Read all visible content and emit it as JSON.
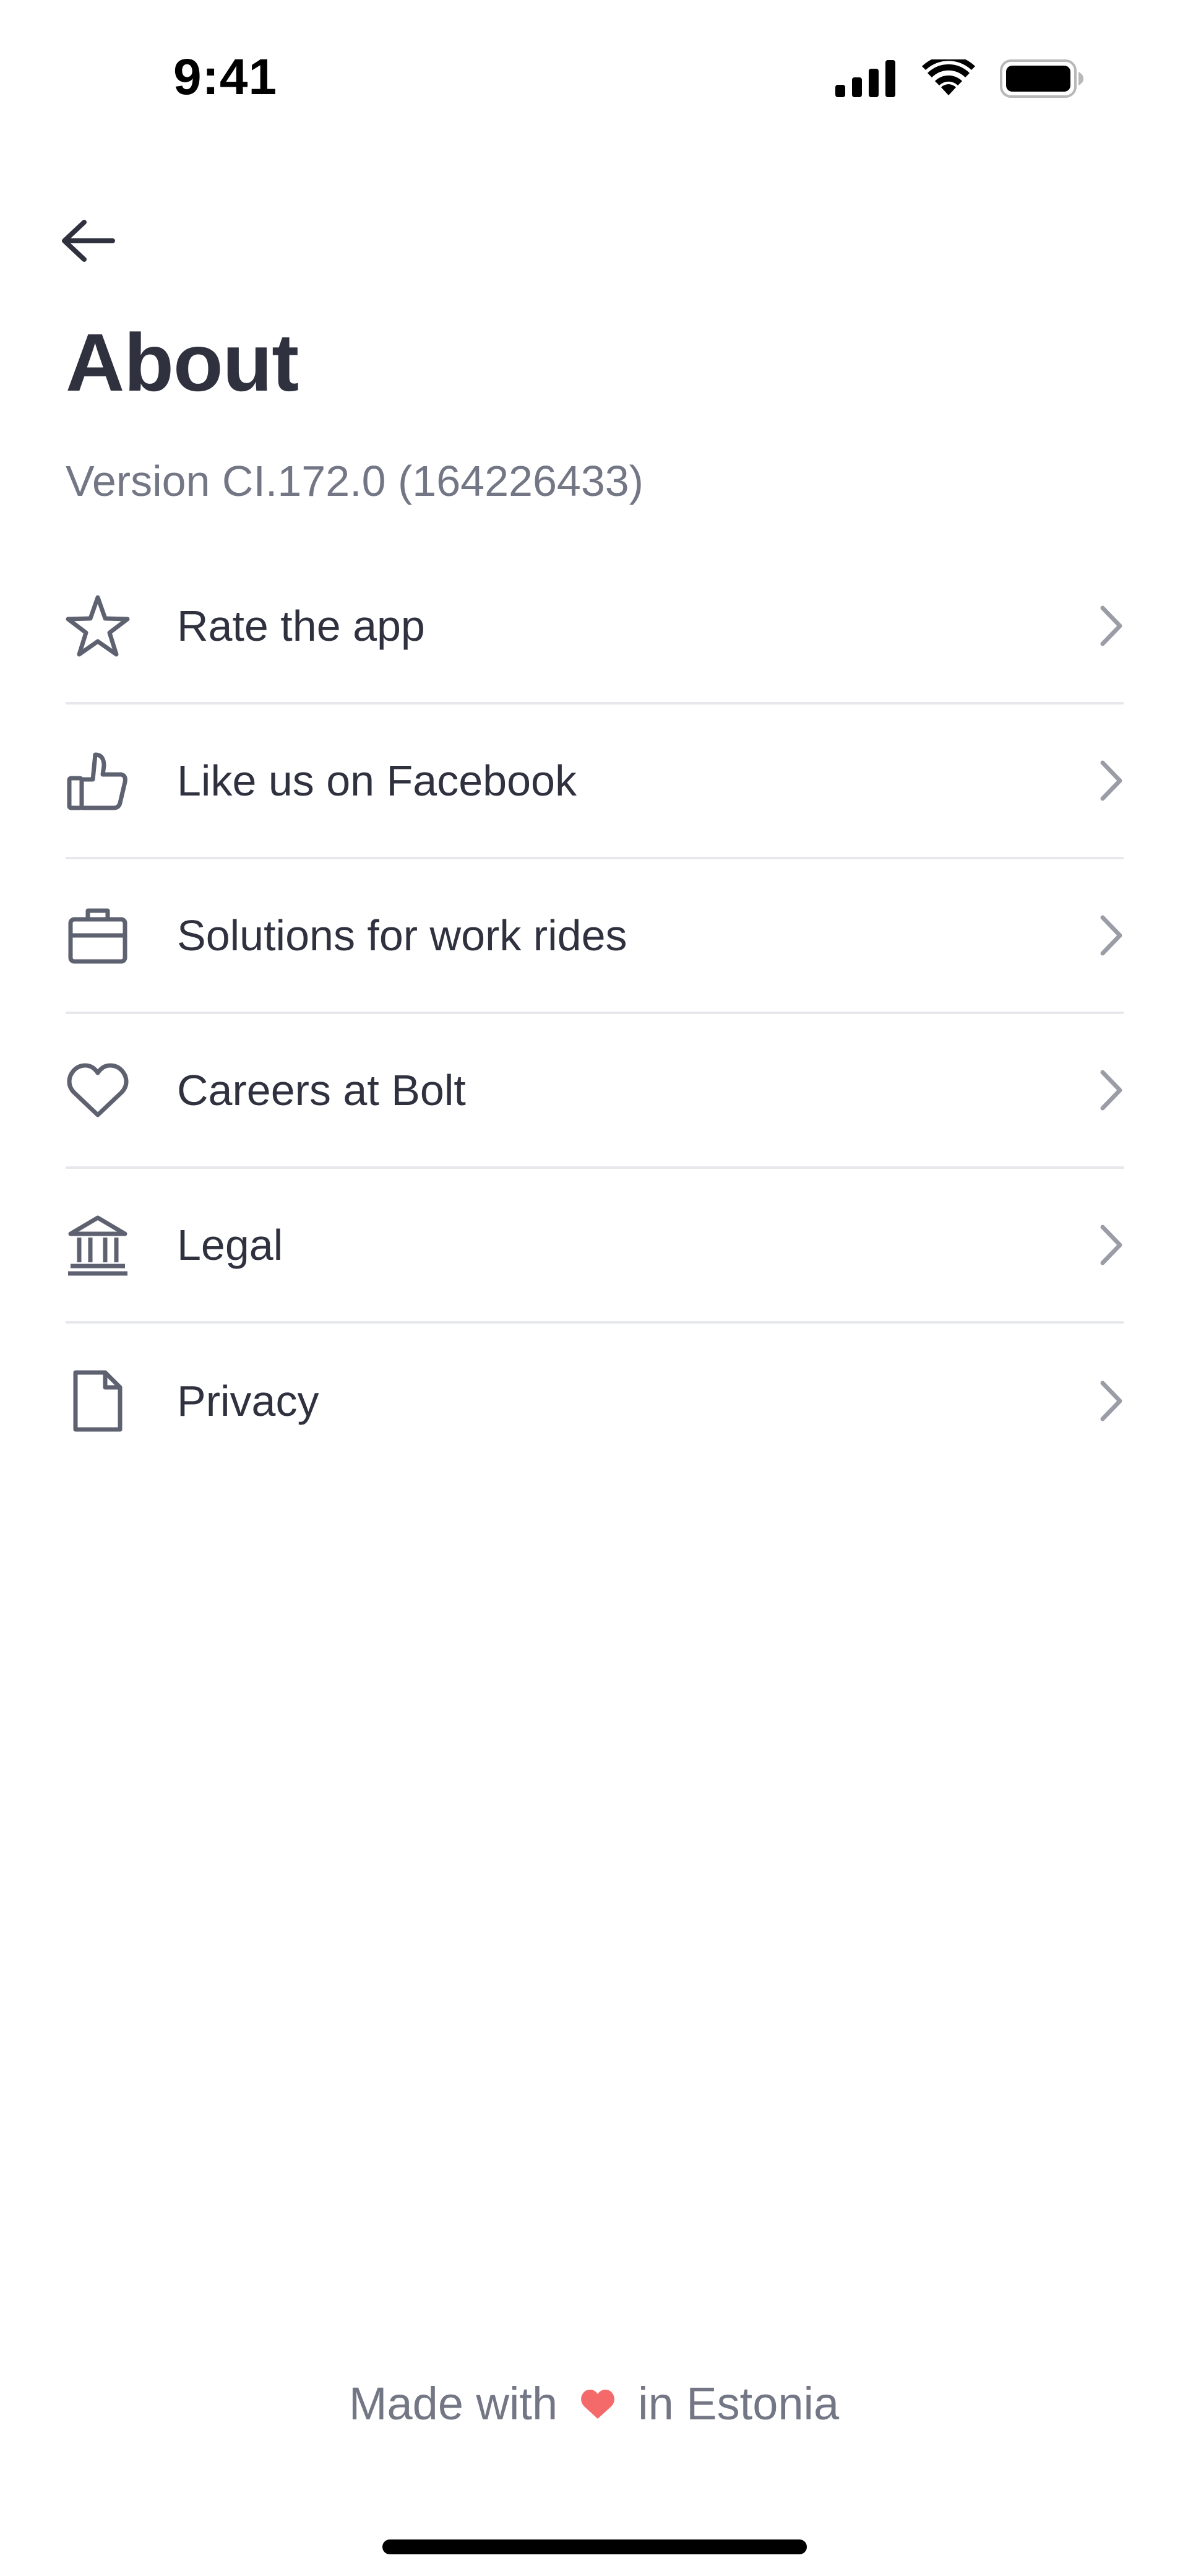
{
  "status_bar": {
    "time": "9:41",
    "icons": [
      "cellular-signal-icon",
      "wifi-icon",
      "battery-icon"
    ]
  },
  "header": {
    "back_icon": "arrow-left-icon",
    "title": "About",
    "version": "Version CI.172.0 (164226433)"
  },
  "menu": {
    "items": [
      {
        "label": "Rate the app",
        "icon": "star-icon"
      },
      {
        "label": "Like us on Facebook",
        "icon": "thumbs-up-icon"
      },
      {
        "label": "Solutions for work rides",
        "icon": "briefcase-icon"
      },
      {
        "label": "Careers at Bolt",
        "icon": "heart-icon"
      },
      {
        "label": "Legal",
        "icon": "bank-icon"
      },
      {
        "label": "Privacy",
        "icon": "document-icon"
      }
    ],
    "chevron_icon": "chevron-right-icon"
  },
  "footer": {
    "before": "Made with",
    "after": "in Estonia",
    "heart_icon": "heart-filled-icon",
    "heart_color": "#f46a6a"
  },
  "colors": {
    "text_primary": "#2f313f",
    "text_secondary": "#737684",
    "icon": "#5e6270",
    "divider": "#e7e8ec",
    "chevron": "#9a9ca6"
  }
}
